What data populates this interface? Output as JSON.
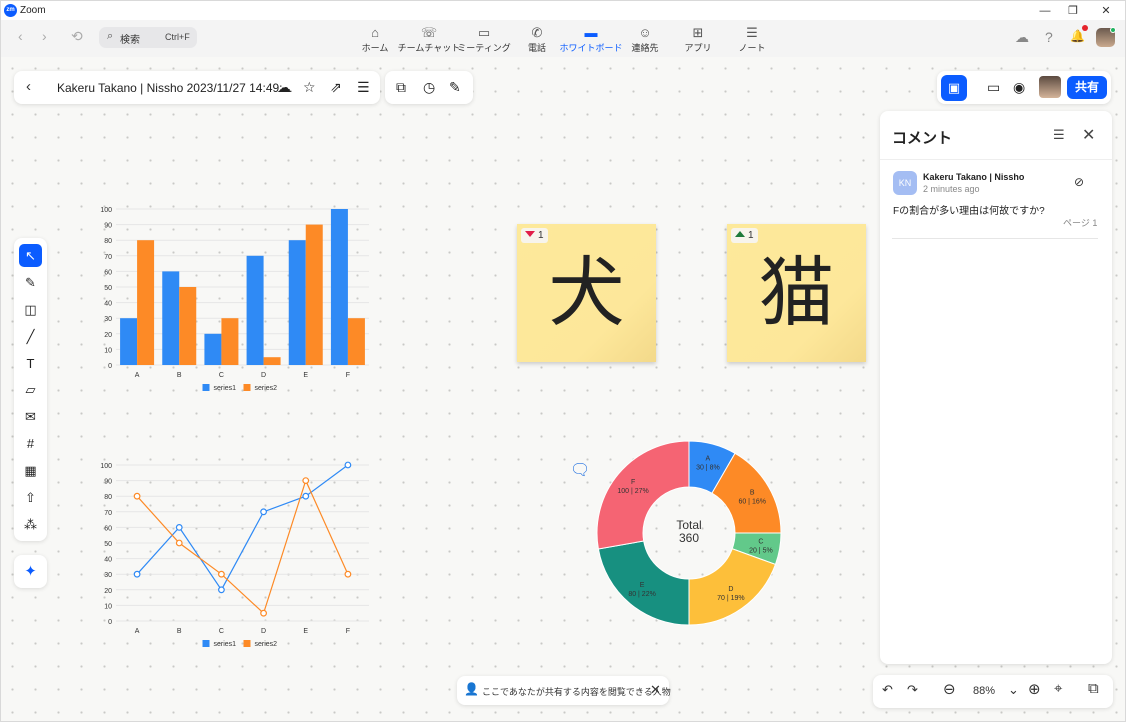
{
  "window": {
    "app_title": "Zoom",
    "logo_text": "zm",
    "minimize": "—",
    "restore": "❐",
    "close": "✕"
  },
  "nav": {
    "back": "‹",
    "forward": "›",
    "history": "⟲",
    "search_placeholder": "検索",
    "search_shortcut": "Ctrl+F",
    "search_icon": "⌕",
    "items": [
      {
        "label": "ホーム",
        "icon": "⌂"
      },
      {
        "label": "チームチャット",
        "icon": "☏"
      },
      {
        "label": "ミーティング",
        "icon": "▭"
      },
      {
        "label": "電話",
        "icon": "✆"
      },
      {
        "label": "ホワイトボード",
        "icon": "▬"
      },
      {
        "label": "連絡先",
        "icon": "☺"
      },
      {
        "label": "アプリ",
        "icon": "⊞"
      },
      {
        "label": "ノート",
        "icon": "☰"
      }
    ],
    "active_index": 4,
    "right_icons": {
      "cloud": "☁",
      "help": "?",
      "bell": "🔔"
    }
  },
  "board": {
    "back": "‹",
    "title": "Kakeru Takano | Nissho 2023/11/27 14:49:...",
    "icons": {
      "cloud": "☁",
      "star": "☆",
      "open": "⇗",
      "menu": "☰",
      "present": "⧉",
      "timer": "◷",
      "draw": "✎"
    },
    "right": {
      "comment": "▣",
      "camera": "▭",
      "reactions": "◉",
      "share": "共有"
    }
  },
  "tools": [
    {
      "name": "select-tool",
      "icon": "↖"
    },
    {
      "name": "pen-tool",
      "icon": "✎"
    },
    {
      "name": "shape-tool",
      "icon": "◫"
    },
    {
      "name": "line-tool",
      "icon": "╱"
    },
    {
      "name": "text-tool",
      "icon": "T"
    },
    {
      "name": "sticky-note-tool",
      "icon": "▱"
    },
    {
      "name": "comment-tool",
      "icon": "✉"
    },
    {
      "name": "frame-tool",
      "icon": "#"
    },
    {
      "name": "template-tool",
      "icon": "▦"
    },
    {
      "name": "upload-tool",
      "icon": "⇧"
    },
    {
      "name": "more-tool",
      "icon": "⁂"
    }
  ],
  "ai_icon": "✦",
  "stickies": [
    {
      "char": "犬",
      "vote": "1",
      "vote_dir": "down"
    },
    {
      "char": "猫",
      "vote": "1",
      "vote_dir": "up"
    }
  ],
  "comments": {
    "title": "コメント",
    "filter_icon": "☰",
    "close_icon": "✕",
    "items": [
      {
        "initials": "KN",
        "author": "Kakeru Takano | Nissho",
        "time": "2 minutes ago",
        "text": "Fの割合が多い理由は何故ですか?",
        "page": "ページ 1",
        "resolve_icon": "⊘"
      }
    ]
  },
  "notice": {
    "text": "ここであなたが共有する内容を閲覧できる人物",
    "icon": "👤",
    "close": "✕"
  },
  "zoom": {
    "level": "88%",
    "undo": "↶",
    "redo": "↷",
    "out": "⊖",
    "in": "⊕",
    "dropdown": "⌄",
    "locate": "⌖",
    "pages": "⧉"
  },
  "chart_data": [
    {
      "type": "bar",
      "categories": [
        "A",
        "B",
        "C",
        "D",
        "E",
        "F"
      ],
      "series": [
        {
          "name": "series1",
          "values": [
            30,
            60,
            20,
            70,
            80,
            100
          ],
          "color": "#2f8af5"
        },
        {
          "name": "series2",
          "values": [
            80,
            50,
            30,
            5,
            90,
            30
          ],
          "color": "#fd8a26"
        }
      ],
      "ylim": [
        0,
        100
      ],
      "yticks": [
        0,
        10,
        20,
        30,
        40,
        50,
        60,
        70,
        80,
        90,
        100
      ],
      "legend": "bottom"
    },
    {
      "type": "line",
      "categories": [
        "A",
        "B",
        "C",
        "D",
        "E",
        "F"
      ],
      "series": [
        {
          "name": "series1",
          "values": [
            30,
            60,
            20,
            70,
            80,
            100
          ],
          "color": "#2f8af5"
        },
        {
          "name": "series2",
          "values": [
            80,
            50,
            30,
            5,
            90,
            30
          ],
          "color": "#fd8a26"
        }
      ],
      "ylim": [
        0,
        100
      ],
      "yticks": [
        0,
        10,
        20,
        30,
        40,
        50,
        60,
        70,
        80,
        90,
        100
      ],
      "legend": "bottom"
    },
    {
      "type": "pie",
      "center_label": "Total",
      "center_value": "360",
      "slices": [
        {
          "label": "A",
          "value": 30,
          "pct": "8%",
          "color": "#2f8af5"
        },
        {
          "label": "B",
          "value": 60,
          "pct": "16%",
          "color": "#fd8a26"
        },
        {
          "label": "C",
          "value": 20,
          "pct": "5%",
          "color": "#62c98a"
        },
        {
          "label": "D",
          "value": 70,
          "pct": "19%",
          "color": "#fdbf3a"
        },
        {
          "label": "E",
          "value": 80,
          "pct": "22%",
          "color": "#179080"
        },
        {
          "label": "F",
          "value": 100,
          "pct": "27%",
          "color": "#f56473"
        }
      ]
    }
  ]
}
